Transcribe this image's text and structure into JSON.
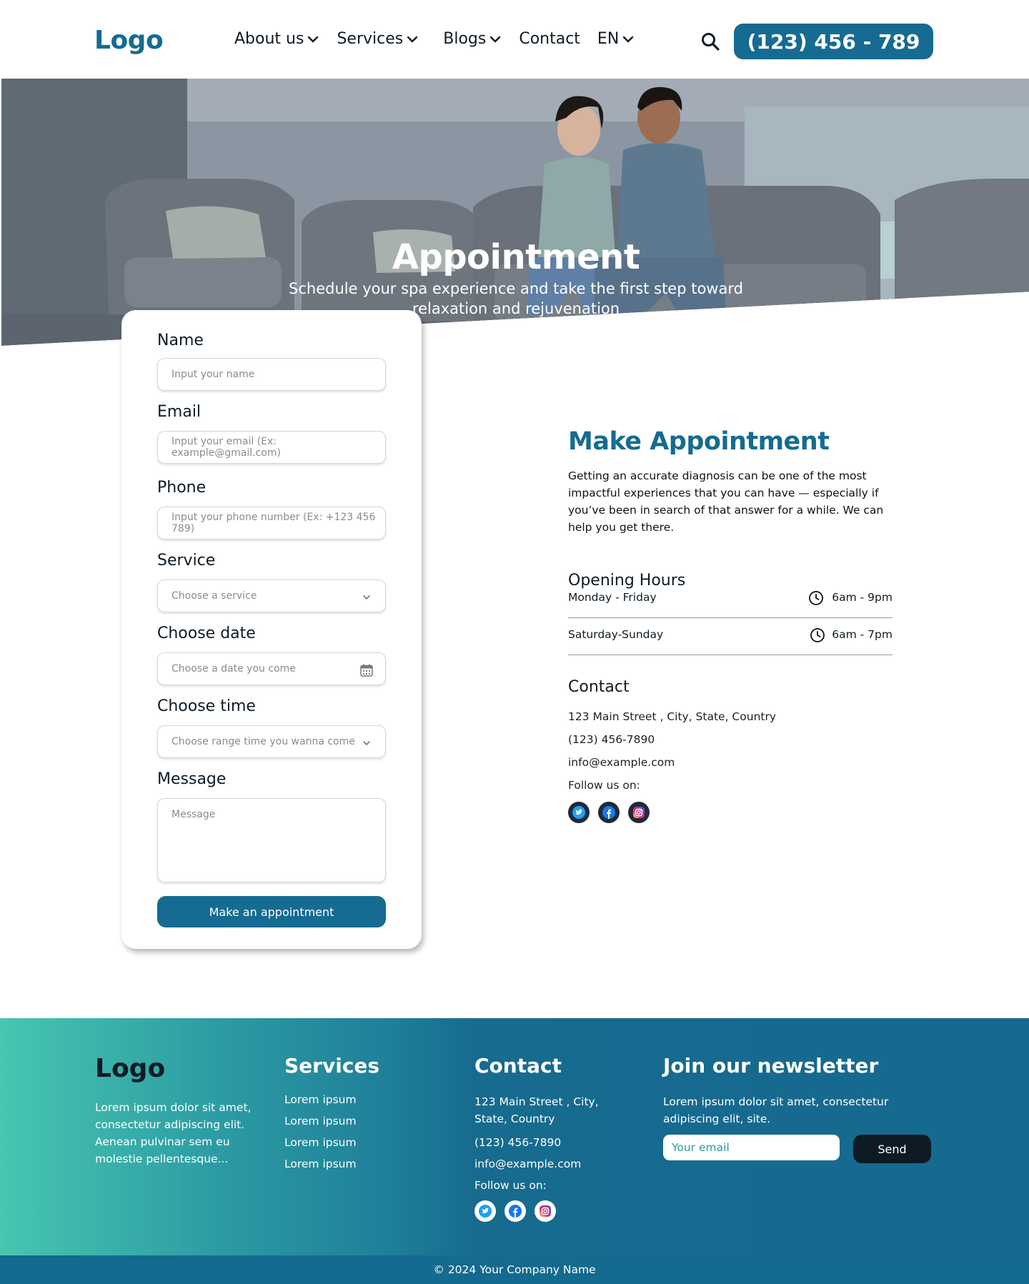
{
  "header": {
    "logo": "Logo",
    "nav": [
      {
        "label": "About us",
        "has_dropdown": true
      },
      {
        "label": "Services",
        "has_dropdown": true
      },
      {
        "label": "Blogs",
        "has_dropdown": true
      },
      {
        "label": "Contact",
        "has_dropdown": false
      },
      {
        "label": "EN",
        "has_dropdown": true
      }
    ],
    "search_icon": "search-icon",
    "phone": "(123) 456 - 789"
  },
  "hero": {
    "title": "Appointment",
    "subtitle": "Schedule your spa experience and take the first step toward relaxation and rejuvenation"
  },
  "form": {
    "name": {
      "label": "Name",
      "placeholder": "Input your name"
    },
    "email": {
      "label": "Email",
      "placeholder": "Input your email (Ex: example@gmail.com)"
    },
    "phone": {
      "label": "Phone",
      "placeholder": "Input your phone number (Ex: +123 456 789)"
    },
    "service": {
      "label": "Service",
      "placeholder": "Choose a service"
    },
    "date": {
      "label": "Choose date",
      "placeholder": "Choose a date you come"
    },
    "time": {
      "label": "Choose time",
      "placeholder": "Choose range time you wanna come"
    },
    "message": {
      "label": "Message",
      "placeholder": "Message"
    },
    "submit": "Make an appointment"
  },
  "info": {
    "title": "Make Appointment",
    "description": "Getting an accurate diagnosis can be one of the most impactful experiences that you can have — especially if you’ve been in search of that answer for a while. We can help you get there.",
    "hours_title": "Opening Hours",
    "hours": [
      {
        "day": "Monday - Friday",
        "time": "6am - 9pm"
      },
      {
        "day": "Saturday-Sunday",
        "time": "6am - 7pm"
      }
    ],
    "contact_title": "Contact",
    "address": "123 Main Street , City, State, Country",
    "phone": "(123) 456-7890",
    "email": "info@example.com",
    "follow": "Follow us on:",
    "socials": [
      "twitter-icon",
      "facebook-icon",
      "instagram-icon"
    ]
  },
  "footer": {
    "logo": "Logo",
    "about": "Lorem ipsum dolor sit amet, consectetur adipiscing elit. Aenean pulvinar sem eu molestie pellentesque...",
    "services_title": "Services",
    "services": [
      "Lorem ipsum",
      "Lorem ipsum",
      "Lorem ipsum",
      "Lorem ipsum"
    ],
    "contact_title": "Contact",
    "address": "123 Main Street , City, State, Country",
    "phone": "(123) 456-7890",
    "email": "info@example.com",
    "follow": "Follow us on:",
    "newsletter_title": "Join our newsletter",
    "newsletter_text": "Lorem ipsum dolor sit amet, consectetur adipiscing elit, site.",
    "email_placeholder": "Your email",
    "send": "Send",
    "copyright": "© 2024 Your Company Name"
  },
  "colors": {
    "brand": "#156b91",
    "dark": "#0f1b24",
    "teal": "#47c6b0"
  }
}
